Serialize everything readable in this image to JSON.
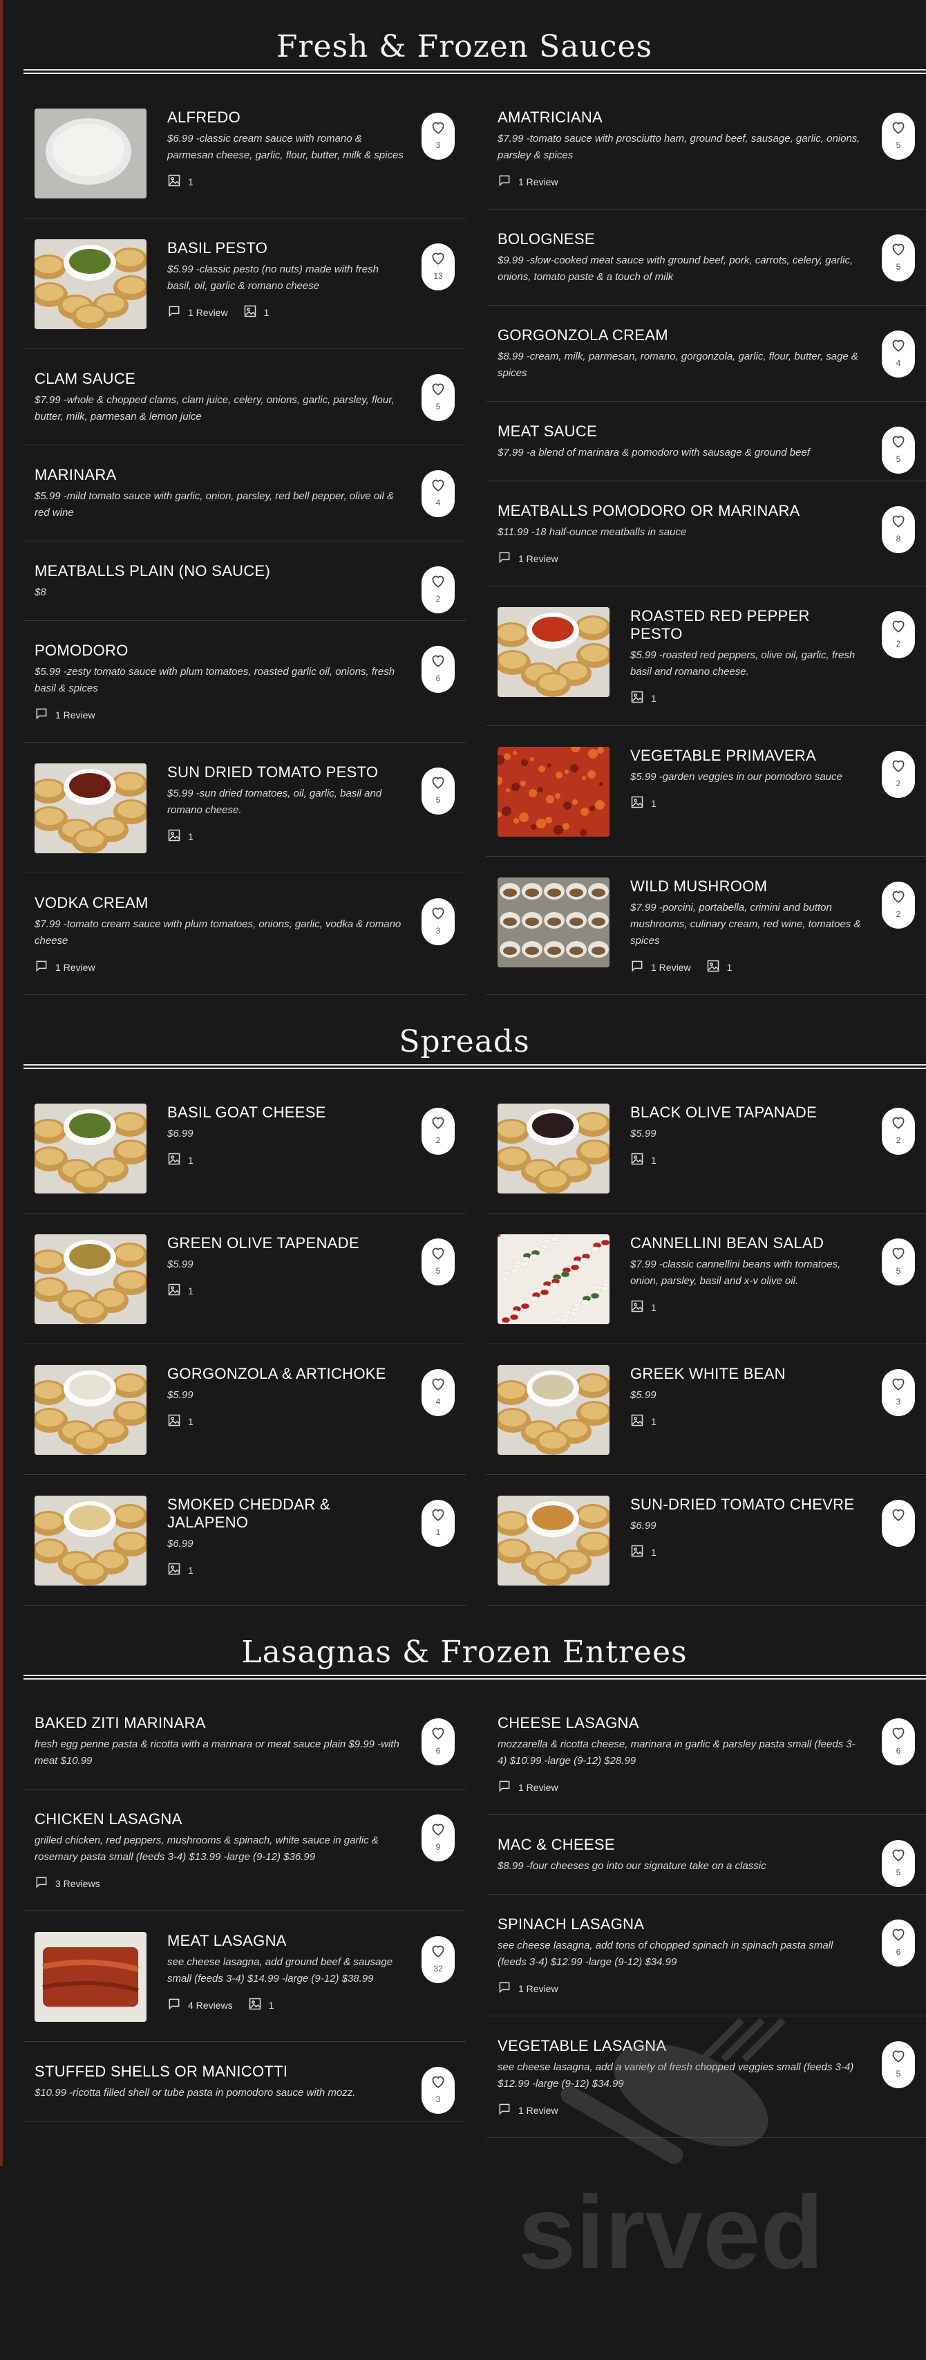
{
  "colors": {
    "background": "#191919",
    "text": "#f2f2f2",
    "like_bg": "#ffffff"
  },
  "watermark": {
    "text": "sirved"
  },
  "icons": {
    "review": "comment-icon",
    "photo": "image-icon",
    "like": "heart-icon"
  },
  "sections": [
    {
      "title": "Fresh & Frozen Sauces",
      "left": [
        {
          "name": "ALFREDO",
          "desc": "$6.99 -classic cream sauce with romano & parmesan cheese, garlic, flour, butter, milk & spices",
          "likes": "3",
          "photos": "1",
          "reviews": "",
          "img": "alfredo"
        },
        {
          "name": "BASIL PESTO",
          "desc": "$5.99 -classic pesto (no nuts) made with fresh basil, oil, garlic & romano cheese",
          "likes": "13",
          "photos": "1",
          "reviews": "1 Review",
          "img": "pesto"
        },
        {
          "name": "CLAM SAUCE",
          "desc": "$7.99 -whole & chopped clams, clam juice, celery, onions, garlic, parsley, flour, butter, milk, parmesan & lemon juice",
          "likes": "5",
          "photos": "",
          "reviews": "",
          "img": ""
        },
        {
          "name": "MARINARA",
          "desc": "$5.99 -mild tomato sauce with garlic, onion, parsley, red bell pepper, olive oil & red wine",
          "likes": "4",
          "photos": "",
          "reviews": "",
          "img": ""
        },
        {
          "name": "MEATBALLS PLAIN (NO SAUCE)",
          "desc": "$8",
          "likes": "2",
          "photos": "",
          "reviews": "",
          "img": ""
        },
        {
          "name": "POMODORO",
          "desc": "$5.99 -zesty tomato sauce with plum tomatoes, roasted garlic oil, onions, fresh basil & spices",
          "likes": "6",
          "photos": "",
          "reviews": "1 Review",
          "img": ""
        },
        {
          "name": "SUN DRIED TOMATO PESTO",
          "desc": "$5.99 -sun dried tomatoes, oil, garlic, basil and romano cheese.",
          "likes": "5",
          "photos": "1",
          "reviews": "",
          "img": "sundried"
        },
        {
          "name": "VODKA CREAM",
          "desc": "$7.99 -tomato cream sauce with plum tomatoes, onions, garlic, vodka & romano cheese",
          "likes": "3",
          "photos": "",
          "reviews": "1 Review",
          "img": ""
        }
      ],
      "right": [
        {
          "name": "AMATRICIANA",
          "desc": "$7.99 -tomato sauce with prosciutto ham, ground beef, sausage, garlic, onions, parsley & spices",
          "likes": "5",
          "photos": "",
          "reviews": "1 Review",
          "img": ""
        },
        {
          "name": "BOLOGNESE",
          "desc": "$9.99 -slow-cooked meat sauce with ground beef, pork, carrots, celery, garlic, onions, tomato paste & a touch of milk",
          "likes": "5",
          "photos": "",
          "reviews": "",
          "img": ""
        },
        {
          "name": "GORGONZOLA CREAM",
          "desc": "$8.99 -cream, milk, parmesan, romano, gorgonzola, garlic, flour, butter, sage & spices",
          "likes": "4",
          "photos": "",
          "reviews": "",
          "img": ""
        },
        {
          "name": "MEAT SAUCE",
          "desc": "$7.99 -a blend of marinara & pomodoro with sausage & ground beef",
          "likes": "5",
          "photos": "",
          "reviews": "",
          "img": ""
        },
        {
          "name": "MEATBALLS POMODORO OR MARINARA",
          "desc": "$11.99 -18 half-ounce meatballs in sauce",
          "likes": "8",
          "photos": "",
          "reviews": "1 Review",
          "img": ""
        },
        {
          "name": "ROASTED RED PEPPER PESTO",
          "desc": "$5.99 -roasted red peppers, olive oil, garlic, fresh basil and romano cheese.",
          "likes": "2",
          "photos": "1",
          "reviews": "",
          "img": "redpepper"
        },
        {
          "name": "VEGETABLE PRIMAVERA",
          "desc": "$5.99 -garden veggies in our pomodoro sauce",
          "likes": "2",
          "photos": "1",
          "reviews": "",
          "img": "primavera"
        },
        {
          "name": "WILD MUSHROOM",
          "desc": "$7.99 -porcini, portabella, crimini and button mushrooms, culinary cream, red wine, tomatoes & spices",
          "likes": "2",
          "photos": "1",
          "reviews": "1 Review",
          "img": "mushroom"
        }
      ]
    },
    {
      "title": "Spreads",
      "left": [
        {
          "name": "BASIL GOAT CHEESE",
          "desc": "$6.99",
          "likes": "2",
          "photos": "1",
          "reviews": "",
          "img": "pesto"
        },
        {
          "name": "GREEN OLIVE TAPENADE",
          "desc": "$5.99",
          "likes": "5",
          "photos": "1",
          "reviews": "",
          "img": "greenolive"
        },
        {
          "name": "GORGONZOLA & ARTICHOKE",
          "desc": "$5.99",
          "likes": "4",
          "photos": "1",
          "reviews": "",
          "img": "gorgonzola"
        },
        {
          "name": "SMOKED CHEDDAR & JALAPENO",
          "desc": "$6.99",
          "likes": "1",
          "photos": "1",
          "reviews": "",
          "img": "cheddar"
        }
      ],
      "right": [
        {
          "name": "BLACK OLIVE TAPANADE",
          "desc": "$5.99",
          "likes": "2",
          "photos": "1",
          "reviews": "",
          "img": "blackolive"
        },
        {
          "name": "CANNELLINI BEAN SALAD",
          "desc": "$7.99 -classic cannellini beans with tomatoes, onion, parsley, basil and x-v olive oil.",
          "likes": "5",
          "photos": "1",
          "reviews": "",
          "img": "bean"
        },
        {
          "name": "GREEK WHITE BEAN",
          "desc": "$5.99",
          "likes": "3",
          "photos": "1",
          "reviews": "",
          "img": "whitebean"
        },
        {
          "name": "SUN-DRIED TOMATO CHEVRE",
          "desc": "$6.99",
          "likes": "",
          "photos": "1",
          "reviews": "",
          "img": "chevre"
        }
      ]
    },
    {
      "title": "Lasagnas & Frozen Entrees",
      "left": [
        {
          "name": "BAKED ZITI MARINARA",
          "desc": "fresh egg penne pasta & ricotta with a marinara or meat sauce plain $9.99 -with meat $10.99",
          "likes": "6",
          "photos": "",
          "reviews": "",
          "img": ""
        },
        {
          "name": "CHICKEN LASAGNA",
          "desc": "grilled chicken, red peppers, mushrooms & spinach, white sauce in garlic & rosemary pasta small (feeds 3-4) $13.99 -large (9-12) $36.99",
          "likes": "9",
          "photos": "",
          "reviews": "3 Reviews",
          "img": ""
        },
        {
          "name": "MEAT LASAGNA",
          "desc": "see cheese lasagna, add ground beef & sausage small (feeds 3-4) $14.99 -large (9-12) $38.99",
          "likes": "32",
          "photos": "1",
          "reviews": "4 Reviews",
          "img": "lasagna"
        },
        {
          "name": "STUFFED SHELLS OR MANICOTTI",
          "desc": "$10.99 -ricotta filled shell or tube pasta in pomodoro sauce with mozz.",
          "likes": "3",
          "photos": "",
          "reviews": "",
          "img": ""
        }
      ],
      "right": [
        {
          "name": "CHEESE LASAGNA",
          "desc": "mozzarella & ricotta cheese, marinara in garlic & parsley pasta small (feeds 3-4) $10.99 -large (9-12) $28.99",
          "likes": "6",
          "photos": "",
          "reviews": "1 Review",
          "img": ""
        },
        {
          "name": "MAC & CHEESE",
          "desc": "$8.99 -four cheeses go into our signature take on a classic",
          "likes": "5",
          "photos": "",
          "reviews": "",
          "img": ""
        },
        {
          "name": "SPINACH LASAGNA",
          "desc": "see cheese lasagna, add tons of chopped spinach in spinach pasta small (feeds 3-4) $12.99 -large (9-12) $34.99",
          "likes": "6",
          "photos": "",
          "reviews": "1 Review",
          "img": ""
        },
        {
          "name": "VEGETABLE LASAGNA",
          "desc": "see cheese lasagna, add a variety of fresh chopped veggies small (feeds 3-4) $12.99 -large (9-12) $34.99",
          "likes": "5",
          "photos": "",
          "reviews": "1 Review",
          "img": ""
        }
      ]
    }
  ]
}
